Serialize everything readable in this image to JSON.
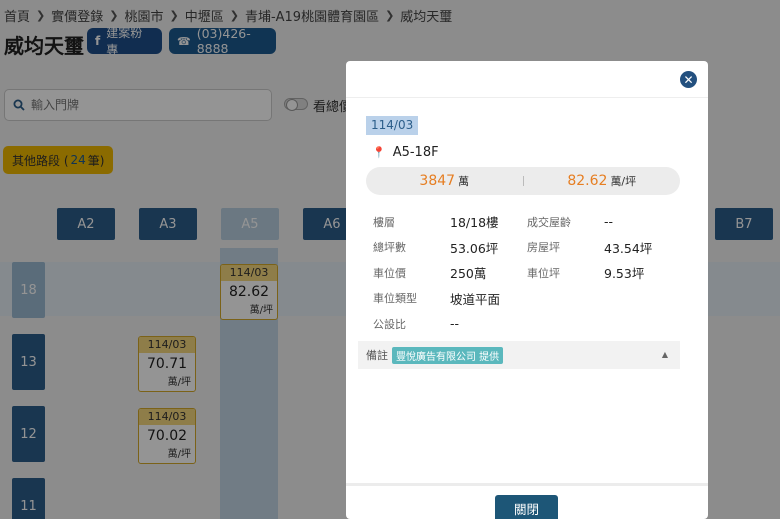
{
  "breadcrumb": [
    "首頁",
    "實價登錄",
    "桃園市",
    "中壢區",
    "青埔-A19桃園體育園區",
    "威均天璽"
  ],
  "page_title": "威均天璽",
  "fb_button": "建案粉專",
  "phone_button": "(03)426-8888",
  "search": {
    "placeholder": "輸入門牌"
  },
  "toggle_label": "看總價",
  "other_road": {
    "prefix": "其他路段 (",
    "count": "24",
    "suffix": " 筆)"
  },
  "columns": [
    "A2",
    "A3",
    "A5",
    "A6",
    "B7"
  ],
  "floors": [
    "18",
    "13",
    "12",
    "11"
  ],
  "cards": [
    {
      "date": "114/03",
      "price": "82.62",
      "unit": "萬/坪"
    },
    {
      "date": "114/03",
      "price": "70.71",
      "unit": "萬/坪"
    },
    {
      "date": "114/03",
      "price": "70.02",
      "unit": "萬/坪"
    }
  ],
  "modal": {
    "date": "114/03",
    "unit": "A5-18F",
    "total_price": "3847",
    "total_unit": "萬",
    "unit_price": "82.62",
    "unit_price_unit": "萬/坪",
    "rows": [
      {
        "k1": "樓層",
        "v1": "18/18樓",
        "k2": "成交屋齡",
        "v2": "--"
      },
      {
        "k1": "總坪數",
        "v1": "53.06坪",
        "k2": "房屋坪",
        "v2": "43.54坪"
      },
      {
        "k1": "車位價",
        "v1": "250萬",
        "k2": "車位坪",
        "v2": "9.53坪"
      },
      {
        "k1": "車位類型",
        "v1": "坡道平面",
        "k2": "",
        "v2": ""
      },
      {
        "k1": "公設比",
        "v1": "--",
        "k2": "",
        "v2": ""
      }
    ],
    "note_label": "備註",
    "note_tag": "豐悅廣告有限公司 提供",
    "close_label": "關閉"
  },
  "colors": {
    "navy": "#2c5e8a",
    "gold": "#f0b900",
    "orange": "#e67e22"
  }
}
